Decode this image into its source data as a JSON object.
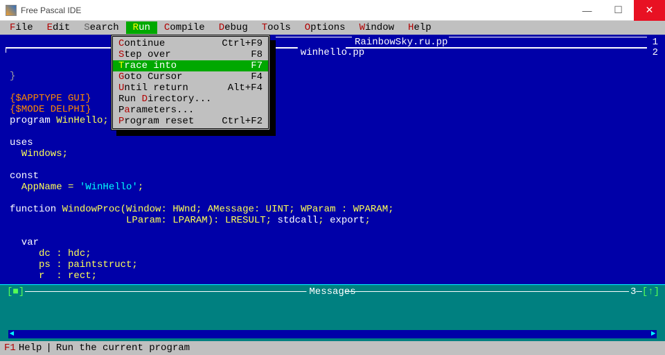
{
  "window": {
    "title": "Free Pascal IDE"
  },
  "menubar": {
    "items": [
      {
        "hk": "F",
        "rest": "ile"
      },
      {
        "hk": "E",
        "rest": "dit"
      },
      {
        "hk": "S",
        "rest": "earch"
      },
      {
        "hk": "R",
        "rest": "un"
      },
      {
        "hk": "C",
        "rest": "ompile"
      },
      {
        "hk": "D",
        "rest": "ebug"
      },
      {
        "hk": "T",
        "rest": "ools"
      },
      {
        "hk": "O",
        "rest": "ptions"
      },
      {
        "hk": "W",
        "rest": "indow"
      },
      {
        "hk": "H",
        "rest": "elp"
      }
    ]
  },
  "tabs": {
    "back": {
      "label": "RainbowSky.ru.pp",
      "num": "1"
    },
    "front": {
      "label": "winhello.pp",
      "num": "2"
    }
  },
  "dropdown": {
    "items": [
      {
        "hk": "C",
        "rest": "ontinue",
        "sc": "Ctrl+F9"
      },
      {
        "hk": "S",
        "rest": "tep over",
        "sc": "F8"
      },
      {
        "hk": "T",
        "rest": "race into",
        "sc": "F7",
        "sel": true
      },
      {
        "hk": "G",
        "rest": "oto Cursor",
        "sc": "F4"
      },
      {
        "hk": "U",
        "rest": "ntil return",
        "sc": "Alt+F4"
      },
      {
        "pre": "Run ",
        "hk": "D",
        "rest": "irectory...",
        "sc": ""
      },
      {
        "pre": "P",
        "hk": "a",
        "rest": "rameters...",
        "sc": ""
      },
      {
        "hk": "P",
        "rest": "rogram reset",
        "sc": "Ctrl+F2"
      }
    ]
  },
  "code": {
    "l1": "}",
    "l3a": "{$APPTYPE GUI}",
    "l4a": "{$MODE DELPHI}",
    "l5a": "program",
    "l5b": " WinHello;",
    "l7a": "uses",
    "l8a": "  Windows;",
    "l10a": "const",
    "l11a": "  AppName = ",
    "l11b": "'WinHello'",
    "l11c": ";",
    "l13a": "function",
    "l13b": " WindowProc(Window: HWnd; AMessage: UINT; WParam : WPARAM;",
    "l14a": "                    LParam: LPARAM): LRESULT; ",
    "l14b": "stdcall",
    "l14c": "; ",
    "l14d": "export",
    "l14e": ";",
    "l16a": "  var",
    "l17a": "     dc : hdc;",
    "l18a": "     ps : paintstruct;",
    "l19a": "     r  : rect;"
  },
  "messages": {
    "title": "Messages",
    "num": "3"
  },
  "status": {
    "f1": "F1",
    "help": "Help",
    "hint": "Run the current program"
  }
}
